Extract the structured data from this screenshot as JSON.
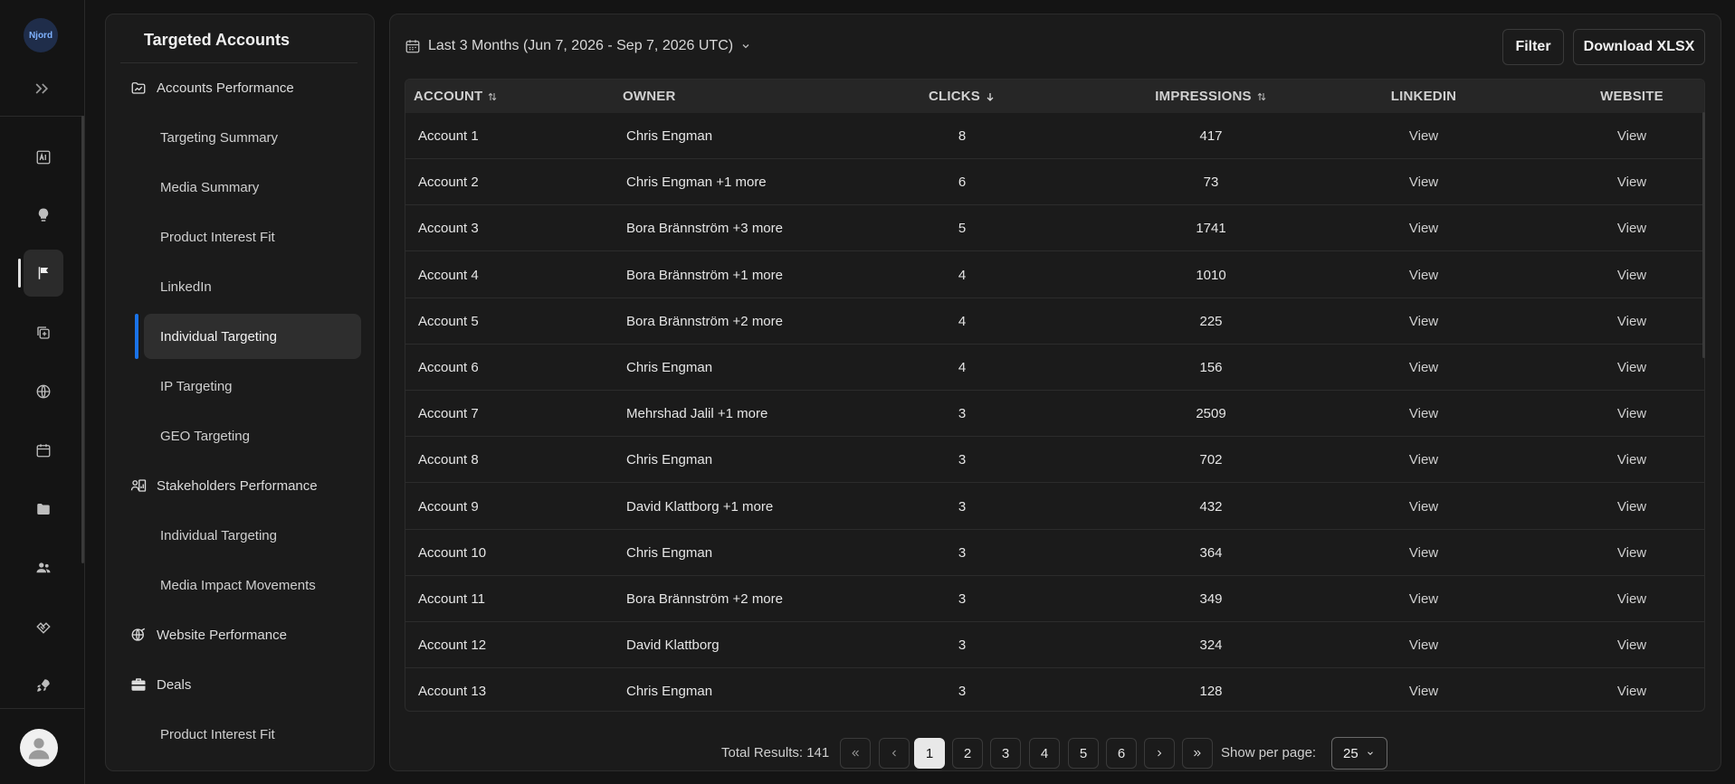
{
  "rail": {
    "logo_text": "Njord",
    "icons": [
      "ai-report-icon",
      "lightbulb-icon",
      "flag-icon",
      "add-copy-icon",
      "globe-icon",
      "calendar-icon",
      "folder-icon",
      "users-icon",
      "handshake-icon",
      "rocket-icon"
    ],
    "active_index": 2
  },
  "subnav": {
    "title": "Targeted Accounts",
    "groups": [
      {
        "label": "Accounts Performance",
        "icon": "accounts-performance-icon"
      },
      {
        "label": "Stakeholders Performance",
        "icon": "stakeholders-performance-icon"
      },
      {
        "label": "Website Performance",
        "icon": "website-performance-icon"
      },
      {
        "label": "Deals",
        "icon": "briefcase-icon"
      }
    ],
    "items": [
      {
        "label": "Targeting Summary"
      },
      {
        "label": "Media Summary"
      },
      {
        "label": "Product Interest Fit"
      },
      {
        "label": "LinkedIn"
      },
      {
        "label": "Individual Targeting",
        "active": true
      },
      {
        "label": "IP Targeting"
      },
      {
        "label": "GEO Targeting"
      },
      {
        "label": "Individual Targeting"
      },
      {
        "label": "Media Impact Movements"
      },
      {
        "label": "Product Interest Fit"
      }
    ]
  },
  "toolbar": {
    "date_range": "Last 3 Months (Jun 7, 2026 - Sep 7, 2026 UTC)",
    "filter_label": "Filter",
    "download_label": "Download XLSX"
  },
  "table": {
    "columns": [
      "ACCOUNT",
      "OWNER",
      "CLICKS",
      "IMPRESSIONS",
      "LINKEDIN",
      "WEBSITE"
    ],
    "rows": [
      {
        "account": "Account 1",
        "owner": "Chris Engman",
        "clicks": "8",
        "impressions": "417",
        "linkedin": "View",
        "website": "View"
      },
      {
        "account": "Account 2",
        "owner": "Chris Engman +1 more",
        "clicks": "6",
        "impressions": "73",
        "linkedin": "View",
        "website": "View"
      },
      {
        "account": "Account 3",
        "owner": "Bora Brännström +3 more",
        "clicks": "5",
        "impressions": "1741",
        "linkedin": "View",
        "website": "View"
      },
      {
        "account": "Account 4",
        "owner": "Bora Brännström +1 more",
        "clicks": "4",
        "impressions": "1010",
        "linkedin": "View",
        "website": "View"
      },
      {
        "account": "Account 5",
        "owner": "Bora Brännström +2 more",
        "clicks": "4",
        "impressions": "225",
        "linkedin": "View",
        "website": "View"
      },
      {
        "account": "Account 6",
        "owner": "Chris Engman",
        "clicks": "4",
        "impressions": "156",
        "linkedin": "View",
        "website": "View"
      },
      {
        "account": "Account 7",
        "owner": "Mehrshad Jalil +1 more",
        "clicks": "3",
        "impressions": "2509",
        "linkedin": "View",
        "website": "View"
      },
      {
        "account": "Account 8",
        "owner": "Chris Engman",
        "clicks": "3",
        "impressions": "702",
        "linkedin": "View",
        "website": "View"
      },
      {
        "account": "Account 9",
        "owner": "David Klattborg +1 more",
        "clicks": "3",
        "impressions": "432",
        "linkedin": "View",
        "website": "View"
      },
      {
        "account": "Account 10",
        "owner": "Chris Engman",
        "clicks": "3",
        "impressions": "364",
        "linkedin": "View",
        "website": "View"
      },
      {
        "account": "Account 11",
        "owner": "Bora Brännström +2 more",
        "clicks": "3",
        "impressions": "349",
        "linkedin": "View",
        "website": "View"
      },
      {
        "account": "Account 12",
        "owner": "David Klattborg",
        "clicks": "3",
        "impressions": "324",
        "linkedin": "View",
        "website": "View"
      },
      {
        "account": "Account 13",
        "owner": "Chris Engman",
        "clicks": "3",
        "impressions": "128",
        "linkedin": "View",
        "website": "View"
      }
    ]
  },
  "pagination": {
    "total_label": "Total Results: 141",
    "pages": [
      "1",
      "2",
      "3",
      "4",
      "5",
      "6"
    ],
    "current": "1",
    "per_page_label": "Show per page:",
    "per_page_value": "25"
  }
}
